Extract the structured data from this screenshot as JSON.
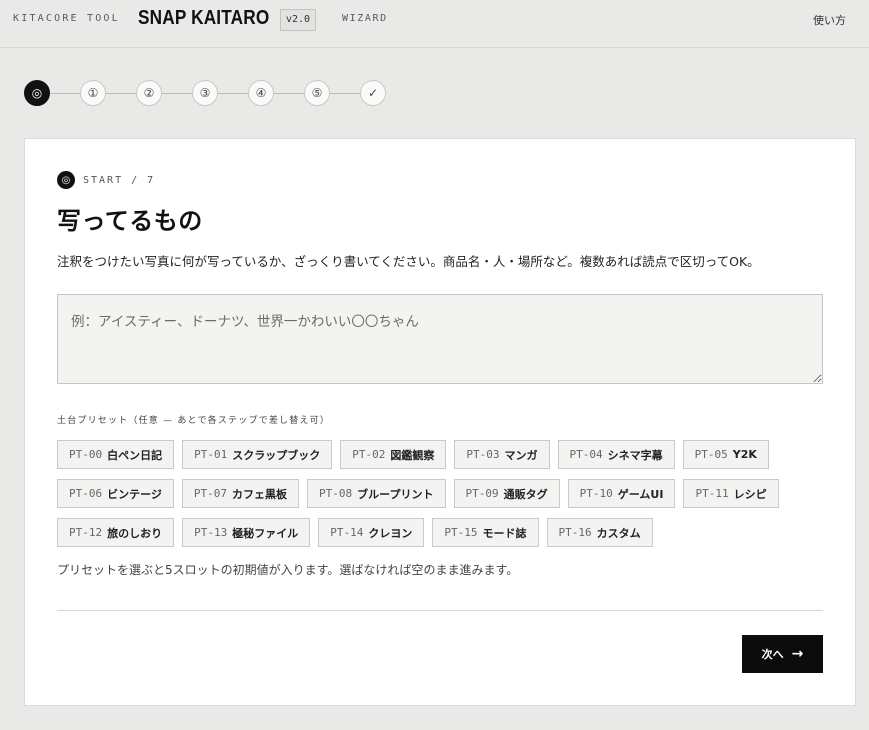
{
  "header": {
    "org": "KITACORE TOOL",
    "title": "SNAP KAITARO",
    "version": "v2.0",
    "mode": "WIZARD",
    "help_link": "使い方"
  },
  "stepper": {
    "steps": [
      "◎",
      "①",
      "②",
      "③",
      "④",
      "⑤",
      "✓"
    ],
    "active_index": 0
  },
  "card": {
    "eyebrow_icon": "◎",
    "eyebrow": "START / 7",
    "title": "写ってるもの",
    "description": "注釈をつけたい写真に何が写っているか、ざっくり書いてください。商品名・人・場所など。複数あれば読点で区切ってOK。",
    "input": {
      "value": "",
      "placeholder": "例：アイスティー、ドーナツ、世界一かわいい〇〇ちゃん"
    },
    "preset_label": "土台プリセット（任意 — あとで各ステップで差し替え可）",
    "presets": [
      [
        {
          "code": "PT-00",
          "name": "白ペン日記"
        },
        {
          "code": "PT-01",
          "name": "スクラップブック"
        },
        {
          "code": "PT-02",
          "name": "図鑑観察"
        },
        {
          "code": "PT-03",
          "name": "マンガ"
        },
        {
          "code": "PT-04",
          "name": "シネマ字幕"
        },
        {
          "code": "PT-05",
          "name": "Y2K"
        }
      ],
      [
        {
          "code": "PT-06",
          "name": "ビンテージ"
        },
        {
          "code": "PT-07",
          "name": "カフェ黒板"
        },
        {
          "code": "PT-08",
          "name": "ブループリント"
        },
        {
          "code": "PT-09",
          "name": "通販タグ"
        },
        {
          "code": "PT-10",
          "name": "ゲームUI"
        },
        {
          "code": "PT-11",
          "name": "レシピ"
        }
      ],
      [
        {
          "code": "PT-12",
          "name": "旅のしおり"
        },
        {
          "code": "PT-13",
          "name": "極秘ファイル"
        },
        {
          "code": "PT-14",
          "name": "クレヨン"
        },
        {
          "code": "PT-15",
          "name": "モード誌"
        },
        {
          "code": "PT-16",
          "name": "カスタム"
        }
      ]
    ],
    "preset_note": "プリセットを選ぶと5スロットの初期値が入ります。選ばなければ空のまま進みます。",
    "next_label": "次へ",
    "next_icon": "→"
  },
  "colors": {
    "background": "#e9e9e8",
    "card": "#ffffff",
    "accent": "#0c0c0c",
    "chip_bg": "#f3f3f1"
  }
}
